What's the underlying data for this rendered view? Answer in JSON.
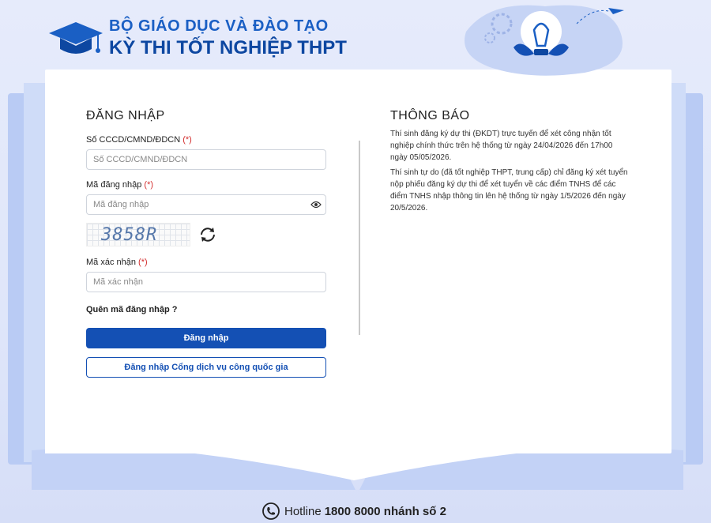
{
  "header": {
    "line1": "BỘ GIÁO DỤC VÀ ĐÀO TẠO",
    "line2": "KỲ THI TỐT NGHIỆP THPT",
    "logo_icon": "graduation-cap-icon"
  },
  "login": {
    "title": "ĐĂNG NHẬP",
    "id_label": "Số CCCD/CMND/ĐDCN",
    "id_placeholder": "Số CCCD/CMND/ĐDCN",
    "password_label": "Mã đăng nhập",
    "password_placeholder": "Mã đăng nhập",
    "captcha_text": "3858R",
    "captcha_label": "Mã xác nhận",
    "captcha_placeholder": "Mã xác nhận",
    "required_mark": "(*)",
    "forgot_label": "Quên mã đăng nhập ?",
    "login_button": "Đăng nhập",
    "national_portal_button": "Đăng nhập Cổng dịch vụ công quốc gia"
  },
  "notice": {
    "title": "THÔNG BÁO",
    "paragraphs": [
      "Thí sinh đăng ký dự thi (ĐKDT) trực tuyến để xét công nhận tốt nghiệp chính thức trên hệ thống từ ngày 24/04/2026 đến 17h00 ngày 05/05/2026.",
      "Thí sinh tự do (đã tốt nghiệp THPT, trung cấp) chỉ đăng ký xét tuyển nộp phiếu đăng ký dự thi để xét tuyển về các điểm TNHS để các điểm TNHS nhập thông tin lên hệ thống từ ngày 1/5/2026 đến ngày 20/5/2026."
    ]
  },
  "footer": {
    "hotline_label": "Hotline",
    "hotline_number": "1800 8000 nhánh số 2"
  },
  "colors": {
    "primary": "#1450b4",
    "title_blue": "#1a5fc4",
    "required": "#d32f2f"
  }
}
